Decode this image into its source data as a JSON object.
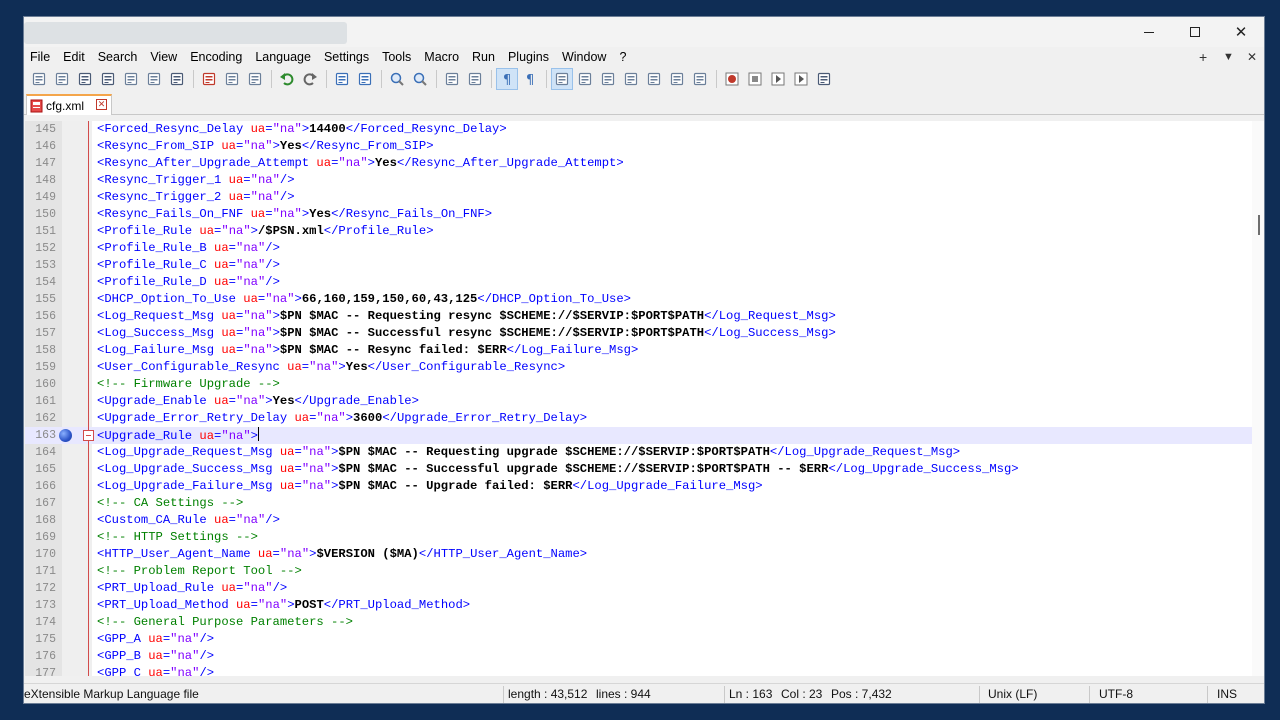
{
  "window": {
    "controls": {
      "minimize_icon": "minimize-icon",
      "maximize_icon": "maximize-icon",
      "close_icon": "close-icon",
      "close_glyph": "✕"
    }
  },
  "menu": {
    "items": [
      "File",
      "Edit",
      "Search",
      "View",
      "Encoding",
      "Language",
      "Settings",
      "Tools",
      "Macro",
      "Run",
      "Plugins",
      "Window",
      "?"
    ],
    "right": {
      "plus": "+",
      "dropdown": "▼",
      "close": "✕"
    }
  },
  "toolbar": {
    "buttons": [
      "new-file-icon",
      "open-file-icon",
      "save-icon",
      "save-all-icon",
      "close-icon",
      "close-all-icon",
      "print-icon",
      "|",
      "cut-icon",
      "copy-icon",
      "paste-icon",
      "|",
      "undo-icon",
      "redo-icon",
      "|",
      "find-icon",
      "replace-icon",
      "|",
      "zoom-in-icon",
      "zoom-out-icon",
      "|",
      "sync-vertical-icon",
      "sync-horizontal-icon",
      "|",
      "word-wrap-icon",
      "show-all-chars-icon",
      "|",
      "indent-guide-icon",
      "udl-icon",
      "doc-map-icon",
      "doc-list-icon",
      "function-list-icon",
      "folder-workspace-icon",
      "monitoring-icon",
      "|",
      "record-macro-icon",
      "stop-record-icon",
      "play-macro-icon",
      "run-macro-multiple-icon",
      "save-macro-icon"
    ],
    "active": [
      "word-wrap-icon",
      "indent-guide-icon"
    ]
  },
  "tab": {
    "label": "cfg.xml",
    "icon": "file-modified-icon",
    "close": "✕"
  },
  "editor": {
    "current_line": 163,
    "bookmark_line": 163,
    "fold_line": 163,
    "lines": [
      {
        "n": "145",
        "parts": [
          [
            "t",
            "<Forced_Resync_Delay "
          ],
          [
            "a",
            "ua"
          ],
          [
            "t",
            "="
          ],
          [
            "v",
            "\"na\""
          ],
          [
            "t",
            ">"
          ],
          [
            "x",
            "14400"
          ],
          [
            "t",
            "</Forced_Resync_Delay>"
          ]
        ]
      },
      {
        "n": "146",
        "parts": [
          [
            "t",
            "<Resync_From_SIP "
          ],
          [
            "a",
            "ua"
          ],
          [
            "t",
            "="
          ],
          [
            "v",
            "\"na\""
          ],
          [
            "t",
            ">"
          ],
          [
            "x",
            "Yes"
          ],
          [
            "t",
            "</Resync_From_SIP>"
          ]
        ]
      },
      {
        "n": "147",
        "parts": [
          [
            "t",
            "<Resync_After_Upgrade_Attempt "
          ],
          [
            "a",
            "ua"
          ],
          [
            "t",
            "="
          ],
          [
            "v",
            "\"na\""
          ],
          [
            "t",
            ">"
          ],
          [
            "x",
            "Yes"
          ],
          [
            "t",
            "</Resync_After_Upgrade_Attempt>"
          ]
        ]
      },
      {
        "n": "148",
        "parts": [
          [
            "t",
            "<Resync_Trigger_1 "
          ],
          [
            "a",
            "ua"
          ],
          [
            "t",
            "="
          ],
          [
            "v",
            "\"na\""
          ],
          [
            "t",
            "/>"
          ]
        ]
      },
      {
        "n": "149",
        "parts": [
          [
            "t",
            "<Resync_Trigger_2 "
          ],
          [
            "a",
            "ua"
          ],
          [
            "t",
            "="
          ],
          [
            "v",
            "\"na\""
          ],
          [
            "t",
            "/>"
          ]
        ]
      },
      {
        "n": "150",
        "parts": [
          [
            "t",
            "<Resync_Fails_On_FNF "
          ],
          [
            "a",
            "ua"
          ],
          [
            "t",
            "="
          ],
          [
            "v",
            "\"na\""
          ],
          [
            "t",
            ">"
          ],
          [
            "x",
            "Yes"
          ],
          [
            "t",
            "</Resync_Fails_On_FNF>"
          ]
        ]
      },
      {
        "n": "151",
        "parts": [
          [
            "t",
            "<Profile_Rule "
          ],
          [
            "a",
            "ua"
          ],
          [
            "t",
            "="
          ],
          [
            "v",
            "\"na\""
          ],
          [
            "t",
            ">"
          ],
          [
            "x",
            "/$PSN.xml"
          ],
          [
            "t",
            "</Profile_Rule>"
          ]
        ]
      },
      {
        "n": "152",
        "parts": [
          [
            "t",
            "<Profile_Rule_B "
          ],
          [
            "a",
            "ua"
          ],
          [
            "t",
            "="
          ],
          [
            "v",
            "\"na\""
          ],
          [
            "t",
            "/>"
          ]
        ]
      },
      {
        "n": "153",
        "parts": [
          [
            "t",
            "<Profile_Rule_C "
          ],
          [
            "a",
            "ua"
          ],
          [
            "t",
            "="
          ],
          [
            "v",
            "\"na\""
          ],
          [
            "t",
            "/>"
          ]
        ]
      },
      {
        "n": "154",
        "parts": [
          [
            "t",
            "<Profile_Rule_D "
          ],
          [
            "a",
            "ua"
          ],
          [
            "t",
            "="
          ],
          [
            "v",
            "\"na\""
          ],
          [
            "t",
            "/>"
          ]
        ]
      },
      {
        "n": "155",
        "parts": [
          [
            "t",
            "<DHCP_Option_To_Use "
          ],
          [
            "a",
            "ua"
          ],
          [
            "t",
            "="
          ],
          [
            "v",
            "\"na\""
          ],
          [
            "t",
            ">"
          ],
          [
            "x",
            "66,160,159,150,60,43,125"
          ],
          [
            "t",
            "</DHCP_Option_To_Use>"
          ]
        ]
      },
      {
        "n": "156",
        "parts": [
          [
            "t",
            "<Log_Request_Msg "
          ],
          [
            "a",
            "ua"
          ],
          [
            "t",
            "="
          ],
          [
            "v",
            "\"na\""
          ],
          [
            "t",
            ">"
          ],
          [
            "x",
            "$PN $MAC -- Requesting resync $SCHEME://$SERVIP:$PORT$PATH"
          ],
          [
            "t",
            "</Log_Request_Msg>"
          ]
        ]
      },
      {
        "n": "157",
        "parts": [
          [
            "t",
            "<Log_Success_Msg "
          ],
          [
            "a",
            "ua"
          ],
          [
            "t",
            "="
          ],
          [
            "v",
            "\"na\""
          ],
          [
            "t",
            ">"
          ],
          [
            "x",
            "$PN $MAC -- Successful resync $SCHEME://$SERVIP:$PORT$PATH"
          ],
          [
            "t",
            "</Log_Success_Msg>"
          ]
        ]
      },
      {
        "n": "158",
        "parts": [
          [
            "t",
            "<Log_Failure_Msg "
          ],
          [
            "a",
            "ua"
          ],
          [
            "t",
            "="
          ],
          [
            "v",
            "\"na\""
          ],
          [
            "t",
            ">"
          ],
          [
            "x",
            "$PN $MAC -- Resync failed: $ERR"
          ],
          [
            "t",
            "</Log_Failure_Msg>"
          ]
        ]
      },
      {
        "n": "159",
        "parts": [
          [
            "t",
            "<User_Configurable_Resync "
          ],
          [
            "a",
            "ua"
          ],
          [
            "t",
            "="
          ],
          [
            "v",
            "\"na\""
          ],
          [
            "t",
            ">"
          ],
          [
            "x",
            "Yes"
          ],
          [
            "t",
            "</User_Configurable_Resync>"
          ]
        ]
      },
      {
        "n": "160",
        "parts": [
          [
            "c",
            "<!-- Firmware Upgrade -->"
          ]
        ]
      },
      {
        "n": "161",
        "parts": [
          [
            "t",
            "<Upgrade_Enable "
          ],
          [
            "a",
            "ua"
          ],
          [
            "t",
            "="
          ],
          [
            "v",
            "\"na\""
          ],
          [
            "t",
            ">"
          ],
          [
            "x",
            "Yes"
          ],
          [
            "t",
            "</Upgrade_Enable>"
          ]
        ]
      },
      {
        "n": "162",
        "parts": [
          [
            "t",
            "<Upgrade_Error_Retry_Delay "
          ],
          [
            "a",
            "ua"
          ],
          [
            "t",
            "="
          ],
          [
            "v",
            "\"na\""
          ],
          [
            "t",
            ">"
          ],
          [
            "x",
            "3600"
          ],
          [
            "t",
            "</Upgrade_Error_Retry_Delay>"
          ]
        ]
      },
      {
        "n": "163",
        "parts": [
          [
            "t",
            "<Upgrade_Rule "
          ],
          [
            "a",
            "ua"
          ],
          [
            "t",
            "="
          ],
          [
            "v",
            "\"na\""
          ],
          [
            "t",
            ">"
          ]
        ]
      },
      {
        "n": "164",
        "parts": [
          [
            "t",
            "<Log_Upgrade_Request_Msg "
          ],
          [
            "a",
            "ua"
          ],
          [
            "t",
            "="
          ],
          [
            "v",
            "\"na\""
          ],
          [
            "t",
            ">"
          ],
          [
            "x",
            "$PN $MAC -- Requesting upgrade $SCHEME://$SERVIP:$PORT$PATH"
          ],
          [
            "t",
            "</Log_Upgrade_Request_Msg>"
          ]
        ]
      },
      {
        "n": "165",
        "parts": [
          [
            "t",
            "<Log_Upgrade_Success_Msg "
          ],
          [
            "a",
            "ua"
          ],
          [
            "t",
            "="
          ],
          [
            "v",
            "\"na\""
          ],
          [
            "t",
            ">"
          ],
          [
            "x",
            "$PN $MAC -- Successful upgrade $SCHEME://$SERVIP:$PORT$PATH -- $ERR"
          ],
          [
            "t",
            "</Log_Upgrade_Success_Msg>"
          ]
        ]
      },
      {
        "n": "166",
        "parts": [
          [
            "t",
            "<Log_Upgrade_Failure_Msg "
          ],
          [
            "a",
            "ua"
          ],
          [
            "t",
            "="
          ],
          [
            "v",
            "\"na\""
          ],
          [
            "t",
            ">"
          ],
          [
            "x",
            "$PN $MAC -- Upgrade failed: $ERR"
          ],
          [
            "t",
            "</Log_Upgrade_Failure_Msg>"
          ]
        ]
      },
      {
        "n": "167",
        "parts": [
          [
            "c",
            "<!-- CA Settings -->"
          ]
        ]
      },
      {
        "n": "168",
        "parts": [
          [
            "t",
            "<Custom_CA_Rule "
          ],
          [
            "a",
            "ua"
          ],
          [
            "t",
            "="
          ],
          [
            "v",
            "\"na\""
          ],
          [
            "t",
            "/>"
          ]
        ]
      },
      {
        "n": "169",
        "parts": [
          [
            "c",
            "<!-- HTTP Settings -->"
          ]
        ]
      },
      {
        "n": "170",
        "parts": [
          [
            "t",
            "<HTTP_User_Agent_Name "
          ],
          [
            "a",
            "ua"
          ],
          [
            "t",
            "="
          ],
          [
            "v",
            "\"na\""
          ],
          [
            "t",
            ">"
          ],
          [
            "x",
            "$VERSION ($MA)"
          ],
          [
            "t",
            "</HTTP_User_Agent_Name>"
          ]
        ]
      },
      {
        "n": "171",
        "parts": [
          [
            "c",
            "<!-- Problem Report Tool -->"
          ]
        ]
      },
      {
        "n": "172",
        "parts": [
          [
            "t",
            "<PRT_Upload_Rule "
          ],
          [
            "a",
            "ua"
          ],
          [
            "t",
            "="
          ],
          [
            "v",
            "\"na\""
          ],
          [
            "t",
            "/>"
          ]
        ]
      },
      {
        "n": "173",
        "parts": [
          [
            "t",
            "<PRT_Upload_Method "
          ],
          [
            "a",
            "ua"
          ],
          [
            "t",
            "="
          ],
          [
            "v",
            "\"na\""
          ],
          [
            "t",
            ">"
          ],
          [
            "x",
            "POST"
          ],
          [
            "t",
            "</PRT_Upload_Method>"
          ]
        ]
      },
      {
        "n": "174",
        "parts": [
          [
            "c",
            "<!-- General Purpose Parameters -->"
          ]
        ]
      },
      {
        "n": "175",
        "parts": [
          [
            "t",
            "<GPP_A "
          ],
          [
            "a",
            "ua"
          ],
          [
            "t",
            "="
          ],
          [
            "v",
            "\"na\""
          ],
          [
            "t",
            "/>"
          ]
        ]
      },
      {
        "n": "176",
        "parts": [
          [
            "t",
            "<GPP_B "
          ],
          [
            "a",
            "ua"
          ],
          [
            "t",
            "="
          ],
          [
            "v",
            "\"na\""
          ],
          [
            "t",
            "/>"
          ]
        ]
      },
      {
        "n": "177",
        "parts": [
          [
            "t",
            "<GPP_C "
          ],
          [
            "a",
            "ua"
          ],
          [
            "t",
            "="
          ],
          [
            "v",
            "\"na\""
          ],
          [
            "t",
            "/>"
          ]
        ]
      }
    ]
  },
  "status": {
    "file_type": "eXtensible Markup Language file",
    "length": "length : 43,512",
    "lines": "lines : 944",
    "ln": "Ln : 163",
    "col": "Col : 23",
    "pos": "Pos : 7,432",
    "eol": "Unix (LF)",
    "encoding": "UTF-8",
    "mode": "INS"
  },
  "colors": {
    "tag": "#0000ff",
    "attr": "#ff0000",
    "value": "#8000ff",
    "text": "#000000",
    "comment": "#008000",
    "current_line": "#e8e8ff",
    "tab_accent": "#f4a54a"
  }
}
